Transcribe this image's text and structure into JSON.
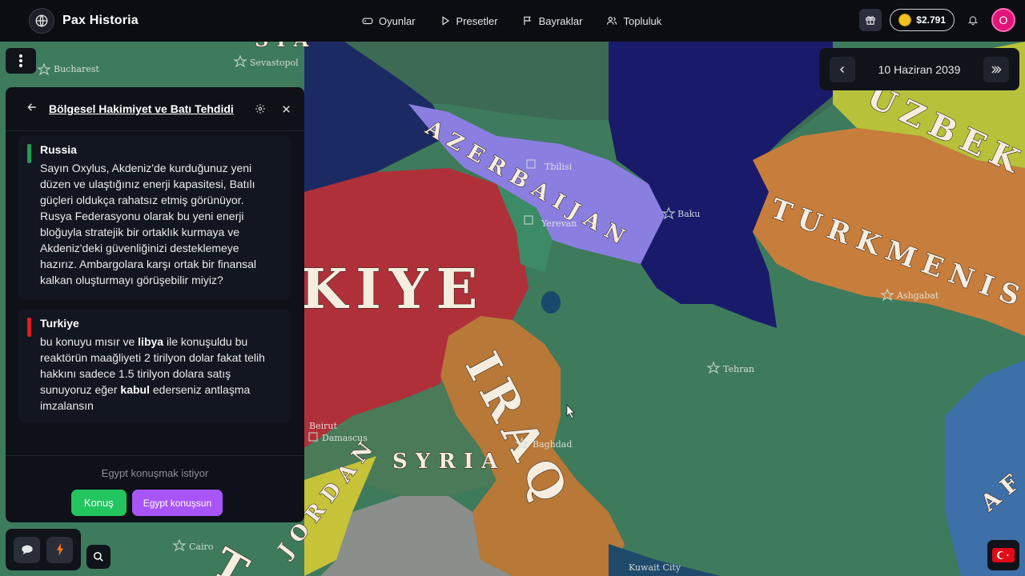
{
  "app": {
    "name": "Pax Historia"
  },
  "nav": [
    {
      "label": "Oyunlar",
      "icon": "gamepad-icon"
    },
    {
      "label": "Presetler",
      "icon": "play-icon"
    },
    {
      "label": "Bayraklar",
      "icon": "flag-icon"
    },
    {
      "label": "Topluluk",
      "icon": "users-icon"
    }
  ],
  "account": {
    "balance": "$2.791",
    "avatar_letter": "O"
  },
  "date_panel": {
    "date": "10 Haziran 2039"
  },
  "chat": {
    "title": "Bölgesel Hakimiyet ve Batı Tehdidi",
    "messages": [
      {
        "sender": "Russia",
        "color": "#1f9d55",
        "text": "Sayın Oxylus, Akdeniz'de kurduğunuz yeni düzen ve ulaştığınız enerji kapasitesi, Batılı güçleri oldukça rahatsız etmiş görünüyor. Rusya Federasyonu olarak bu yeni enerji bloğuyla stratejik bir ortaklık kurmaya ve Akdeniz'deki güvenliğinizi desteklemeye hazırız. Ambargolara karşı ortak bir finansal kalkan oluşturmayı görüşebilir miyiz?"
      },
      {
        "sender": "Turkiye",
        "color": "#e11d1d",
        "text_parts": [
          "bu konuyu mısır ve ",
          "libya",
          " ile konuşuldu bu reaktörün maağliyeti 2 tirilyon dolar fakat telih hakkını sadece 1.5 tirilyon dolara satış sunuyoruz eğer ",
          "kabul",
          " ederseniz antlaşma imzalansın"
        ]
      }
    ],
    "footer_note": "Egypt konuşmak istiyor",
    "talk_button": "Konuş",
    "let_talk_button": "Egypt konuşsun"
  },
  "map": {
    "labels": [
      "AZERBAIJAN",
      "TURKMENISTAN",
      "UZBEK",
      "KIYE",
      "IRAQ",
      "SYRIA",
      "JORDAN",
      "AF",
      "SIA",
      "T"
    ],
    "cities": [
      "Bucharest",
      "Sevastopol",
      "Tbilisi",
      "Yerevan",
      "Baku",
      "Ashgabat",
      "Tehran",
      "Baghdad",
      "Damascus",
      "Kuwait City",
      "Cairo",
      "Beirut"
    ],
    "colors": {
      "turkiye": "#b0303a",
      "azerbaijan": "#8a7fe0",
      "turkmenistan": "#c77d3c",
      "iraq": "#b87838",
      "iran": "#3e7a5c",
      "uzbekistan": "#b8c13a",
      "caspian": "#1a1a6b",
      "black_sea": "#1c2a63",
      "jordan": "#c7c338",
      "syria": "#4a7a58",
      "armenia": "#3d8a66",
      "russia": "#3c6a54"
    }
  }
}
